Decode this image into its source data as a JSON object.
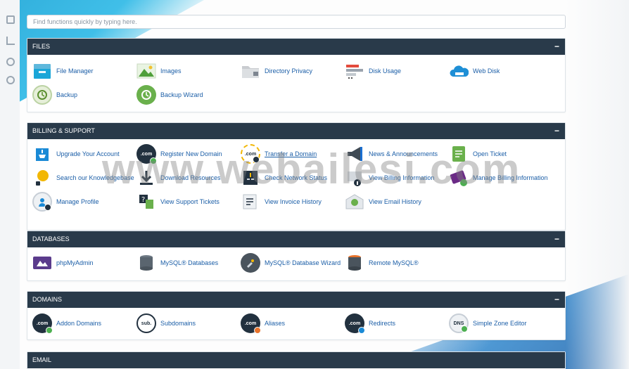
{
  "search": {
    "placeholder": "Find functions quickly by typing here."
  },
  "watermark": "www.webailesi.com",
  "panels": {
    "files": {
      "title": "FILES",
      "items": [
        "File Manager",
        "Images",
        "Directory Privacy",
        "Disk Usage",
        "Web Disk",
        "Backup",
        "Backup Wizard"
      ]
    },
    "billing": {
      "title": "BILLING & SUPPORT",
      "items": [
        "Upgrade Your Account",
        "Register New Domain",
        "Transfer a Domain",
        "News & Announcements",
        "Open Ticket",
        "Search our Knowledgebase",
        "Download Resources",
        "Check Network Status",
        "View Billing Information",
        "Manage Billing Information",
        "Manage Profile",
        "View Support Tickets",
        "View Invoice History",
        "View Email History"
      ]
    },
    "databases": {
      "title": "DATABASES",
      "items": [
        "phpMyAdmin",
        "MySQL® Databases",
        "MySQL® Database Wizard",
        "Remote MySQL®"
      ]
    },
    "domains": {
      "title": "DOMAINS",
      "items": [
        "Addon Domains",
        "Subdomains",
        "Aliases",
        "Redirects",
        "Simple Zone Editor"
      ]
    },
    "email": {
      "title": "EMAIL"
    }
  },
  "icon_text": {
    "dotcom": ".com",
    "sub": "sub.",
    "dns": "DNS"
  },
  "collapse_symbol": "−",
  "colors": {
    "header": "#293a4a",
    "link": "#1b5ea7",
    "accent_blue": "#1aa6d8"
  }
}
